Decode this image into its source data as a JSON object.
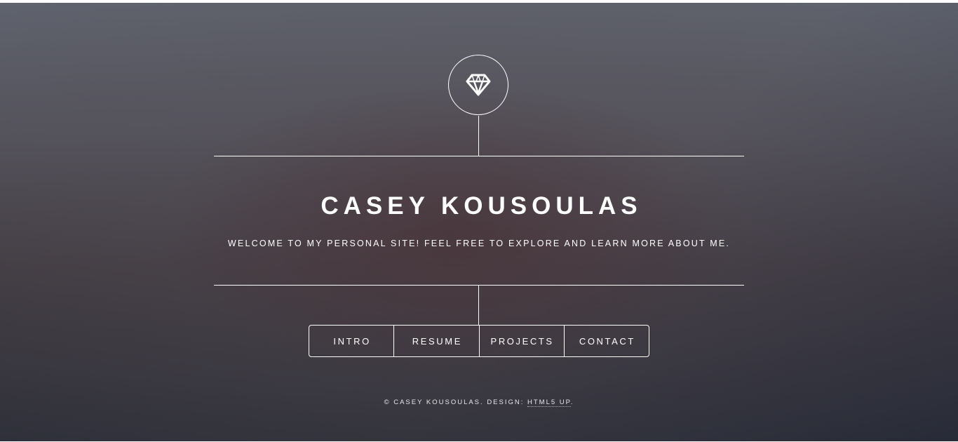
{
  "header": {
    "logo_icon": "diamond-icon",
    "name": "CASEY KOUSOULAS",
    "tagline": "WELCOME TO MY PERSONAL SITE! FEEL FREE TO EXPLORE AND LEARN MORE ABOUT ME."
  },
  "nav": {
    "items": [
      {
        "label": "INTRO"
      },
      {
        "label": "RESUME"
      },
      {
        "label": "PROJECTS"
      },
      {
        "label": "CONTACT"
      }
    ]
  },
  "footer": {
    "copyright": "© CASEY KOUSOULAS.",
    "design_label": "DESIGN:",
    "design_link": "HTML5 UP",
    "end": "."
  },
  "colors": {
    "text": "#ffffff",
    "lines": "#ffffff"
  }
}
